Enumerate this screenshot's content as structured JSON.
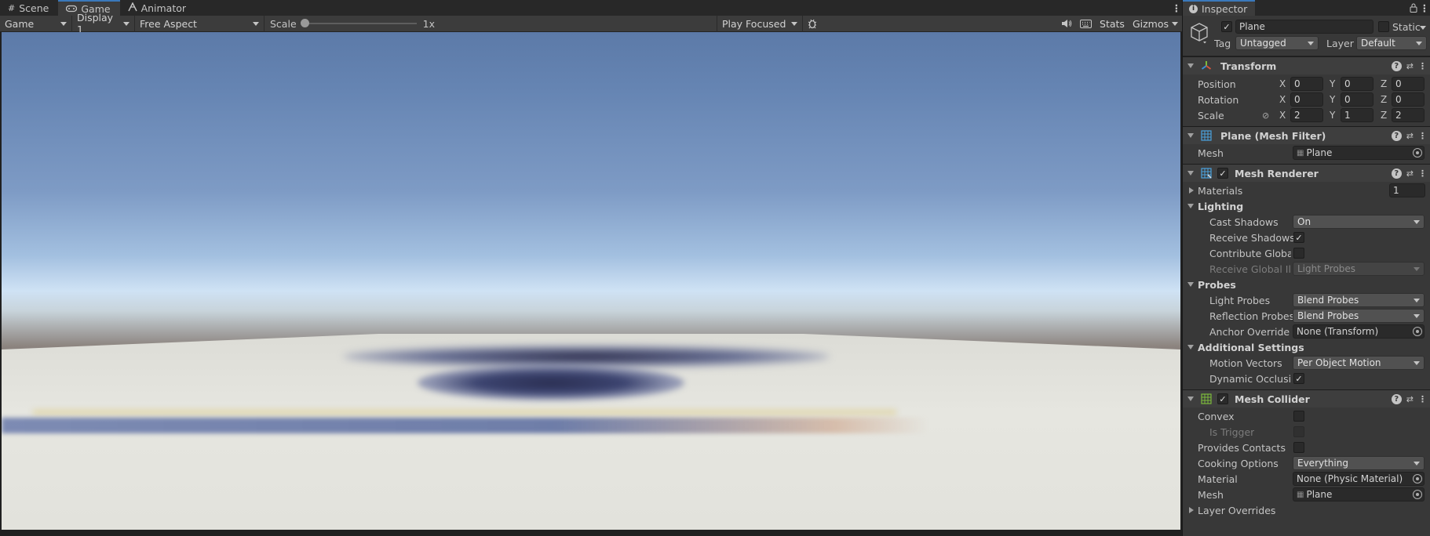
{
  "game": {
    "tabs": [
      {
        "label": "Scene",
        "icon": "grid-icon"
      },
      {
        "label": "Game",
        "icon": "gamepad-icon"
      },
      {
        "label": "Animator",
        "icon": "animator-icon"
      }
    ],
    "toolbar": {
      "view_select": "Game",
      "display": "Display 1",
      "aspect": "Free Aspect",
      "scale_label": "Scale",
      "scale_value": "1x",
      "play_mode": "Play Focused",
      "stats": "Stats",
      "gizmos": "Gizmos"
    }
  },
  "inspector": {
    "tab_label": "Inspector",
    "object": {
      "name": "Plane",
      "active": true,
      "static_label": "Static",
      "tag_label": "Tag",
      "tag_value": "Untagged",
      "layer_label": "Layer",
      "layer_value": "Default"
    },
    "transform": {
      "title": "Transform",
      "position": {
        "label": "Position",
        "x": "0",
        "y": "0",
        "z": "0"
      },
      "rotation": {
        "label": "Rotation",
        "x": "0",
        "y": "0",
        "z": "0"
      },
      "scale": {
        "label": "Scale",
        "x": "2",
        "y": "1",
        "z": "2"
      },
      "axes": {
        "x": "X",
        "y": "Y",
        "z": "Z"
      }
    },
    "mesh_filter": {
      "title": "Plane (Mesh Filter)",
      "mesh_label": "Mesh",
      "mesh_value": "Plane"
    },
    "mesh_renderer": {
      "title": "Mesh Renderer",
      "materials_label": "Materials",
      "materials_count": "1",
      "lighting_label": "Lighting",
      "cast_shadows_label": "Cast Shadows",
      "cast_shadows_value": "On",
      "receive_shadows_label": "Receive Shadows",
      "contribute_gi_label": "Contribute Global I",
      "receive_gi_label": "Receive Global Illu",
      "receive_gi_value": "Light Probes",
      "probes_label": "Probes",
      "light_probes_label": "Light Probes",
      "light_probes_value": "Blend Probes",
      "reflection_probes_label": "Reflection Probes",
      "reflection_probes_value": "Blend Probes",
      "anchor_override_label": "Anchor Override",
      "anchor_override_value": "None (Transform)",
      "additional_settings_label": "Additional Settings",
      "motion_vectors_label": "Motion Vectors",
      "motion_vectors_value": "Per Object Motion",
      "dynamic_occlusion_label": "Dynamic Occlusio"
    },
    "mesh_collider": {
      "title": "Mesh Collider",
      "convex_label": "Convex",
      "is_trigger_label": "Is Trigger",
      "provides_contacts_label": "Provides Contacts",
      "cooking_options_label": "Cooking Options",
      "cooking_options_value": "Everything",
      "material_label": "Material",
      "material_value": "None (Physic Material)",
      "mesh_label": "Mesh",
      "mesh_value": "Plane",
      "layer_overrides_label": "Layer Overrides"
    }
  }
}
